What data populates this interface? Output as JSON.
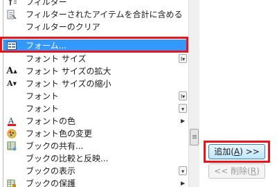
{
  "commands": [
    {
      "label": "フィルター",
      "icon": "filter-icon"
    },
    {
      "label": "フィルターされたアイテムを合計に含める",
      "icon": "include-filtered-totals-icon"
    },
    {
      "label": "フィルターのクリア",
      "icon": ""
    },
    {
      "label": "フォーム...",
      "icon": "form-icon",
      "selected": true
    },
    {
      "label": "フォント サイズ",
      "icon": "",
      "submenu": "combo"
    },
    {
      "label": "フォント サイズの拡大",
      "icon": "grow-font-icon"
    },
    {
      "label": "フォント サイズの縮小",
      "icon": "shrink-font-icon"
    },
    {
      "label": "フォント",
      "icon": "",
      "submenu": "combo"
    },
    {
      "label": "フォント",
      "icon": "",
      "submenu": "dropdown"
    },
    {
      "label": "フォントの色",
      "icon": "font-color-icon",
      "submenu": "arrow"
    },
    {
      "label": "フォント色の変更",
      "icon": "font-color-change-icon"
    },
    {
      "label": "ブックの共有...",
      "icon": "share-workbook-icon"
    },
    {
      "label": "ブックの比較と反映...",
      "icon": ""
    },
    {
      "label": "ブックの表示",
      "icon": "",
      "submenu": "dropdown"
    },
    {
      "label": "ブックの保護",
      "icon": "protect-workbook-icon",
      "submenu": "arrow"
    }
  ],
  "buttons": {
    "add": {
      "text": "追加(",
      "mnemonic": "A",
      "suffix": ") >>"
    },
    "remove": {
      "text": "<< 削除(",
      "mnemonic": "R",
      "suffix": ")"
    }
  },
  "colors": {
    "selection": "#3399ff",
    "highlight_frame": "#e8141c",
    "font_color_bar": "#e8141c"
  }
}
